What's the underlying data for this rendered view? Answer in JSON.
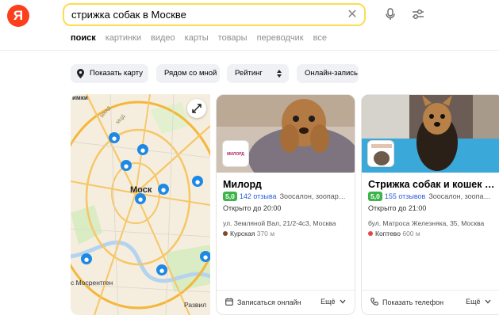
{
  "logo": {
    "letter": "Я"
  },
  "search": {
    "query": "стрижка собак в Москве",
    "clear_icon": "close-icon"
  },
  "tabs": [
    {
      "label": "поиск",
      "active": true
    },
    {
      "label": "картинки"
    },
    {
      "label": "видео"
    },
    {
      "label": "карты"
    },
    {
      "label": "товары"
    },
    {
      "label": "переводчик"
    },
    {
      "label": "все"
    }
  ],
  "filters": {
    "show_map": "Показать карту",
    "nearby": "Рядом со мной",
    "rating": "Рейтинг",
    "online_booking": "Онлайн-запись"
  },
  "map": {
    "labels": {
      "top_left": "имки",
      "center": "Моск",
      "bottom_left": "с Мосрентген",
      "bottom_right": "Развил",
      "ring1": "МКАД",
      "ring2": "МЦД"
    }
  },
  "cards": [
    {
      "title": "Милорд",
      "rating": "5,0",
      "reviews": "142 отзыва",
      "category": "Зоосалон, зоопар…",
      "hours": "Открыто до 20:00",
      "address": "ул. Земляной Вал, 21/2-4с3, Москва",
      "metro": "Курская",
      "metro_distance": "370 м",
      "metro_color": "#7b4b2a",
      "action": "Записаться онлайн",
      "more": "Ещё",
      "thumb_text": "МИЛОРД"
    },
    {
      "title": "Стрижка собак и кошек …",
      "rating": "5,0",
      "reviews": "155 отзывов",
      "category": "Зоосалон, зоопа…",
      "hours": "Открыто до 21:00",
      "address": "бул. Матроса Железняка, 35, Москва",
      "metro": "Коптево",
      "metro_distance": "600 м",
      "metro_color": "#e8424b",
      "action": "Показать телефон",
      "more": "Ещё"
    }
  ]
}
